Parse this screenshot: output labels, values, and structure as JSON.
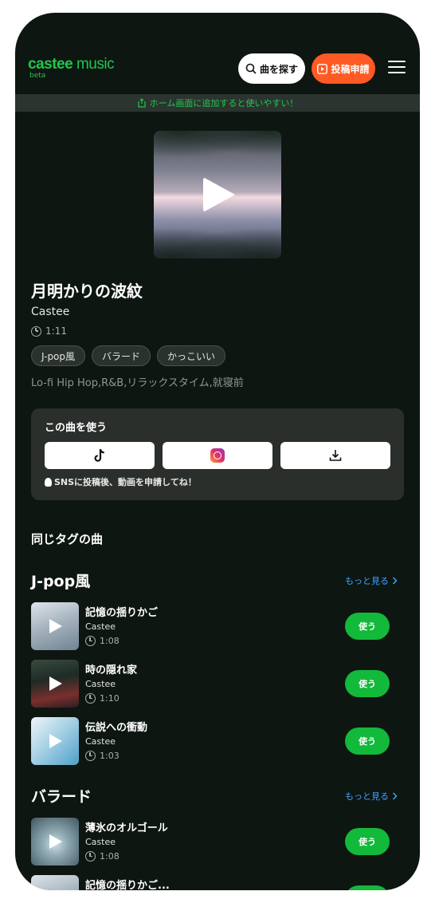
{
  "header": {
    "logo_bold": "castee",
    "logo_light": " music",
    "beta": "beta",
    "search_label": "曲を探す",
    "post_label": "投稿申請"
  },
  "banner": {
    "text": "ホーム画面に追加すると使いやすい！"
  },
  "song": {
    "title": "月明かりの波紋",
    "artist": "Castee",
    "duration": "1:11",
    "tags": [
      "J-pop風",
      "バラード",
      "かっこいい"
    ],
    "genres": "Lo-fi Hip Hop,R&B,リラックスタイム,就寝前"
  },
  "use_panel": {
    "title": "この曲を使う",
    "hint": "SNSに投稿後、動画を申請してね！"
  },
  "same_tag_heading": "同じタグの曲",
  "sections": [
    {
      "title": "J-pop風",
      "more": "もっと見る",
      "tracks": [
        {
          "title": "記憶の揺りかご",
          "artist": "Castee",
          "duration": "1:08",
          "use": "使う"
        },
        {
          "title": "時の隠れ家",
          "artist": "Castee",
          "duration": "1:10",
          "use": "使う"
        },
        {
          "title": "伝説への衝動",
          "artist": "Castee",
          "duration": "1:03",
          "use": "使う"
        }
      ]
    },
    {
      "title": "バラード",
      "more": "もっと見る",
      "tracks": [
        {
          "title": "薄氷のオルゴール",
          "artist": "Castee",
          "duration": "1:08",
          "use": "使う"
        },
        {
          "title": "記憶の揺りかご...",
          "artist": "",
          "duration": "",
          "use": ""
        }
      ]
    }
  ],
  "colors": {
    "accent": "#1ec84d",
    "post": "#ff5a24",
    "use_button": "#12b93a",
    "link": "#3ea2ff",
    "background": "#0e1611"
  }
}
